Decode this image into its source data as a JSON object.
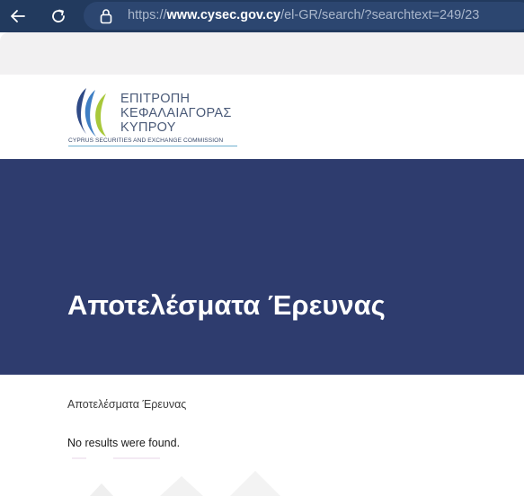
{
  "browser": {
    "url_protocol": "https://",
    "url_host": "www.cysec.gov.cy",
    "url_path": "/el-GR/search/?searchtext=249/23",
    "colors": {
      "bar": "#223a5e",
      "pill": "#2c4670"
    }
  },
  "logo": {
    "line1": "ΕΠΙΤΡΟΠΗ",
    "line2": "ΚΕΦΑΛΑΙΑΓΟΡΑΣ",
    "line3": "ΚΥΠΡΟΥ",
    "subtitle": "CYPRUS SECURITIES AND EXCHANGE COMMISSION"
  },
  "banner": {
    "title": "Αποτελέσματα Έρευνας",
    "color": "#2e3c6e"
  },
  "content": {
    "breadcrumb": "Αποτελέσματα Έρευνας",
    "message": "No results were found."
  },
  "icons": [
    "back-arrow-icon",
    "reload-icon",
    "lock-icon"
  ]
}
